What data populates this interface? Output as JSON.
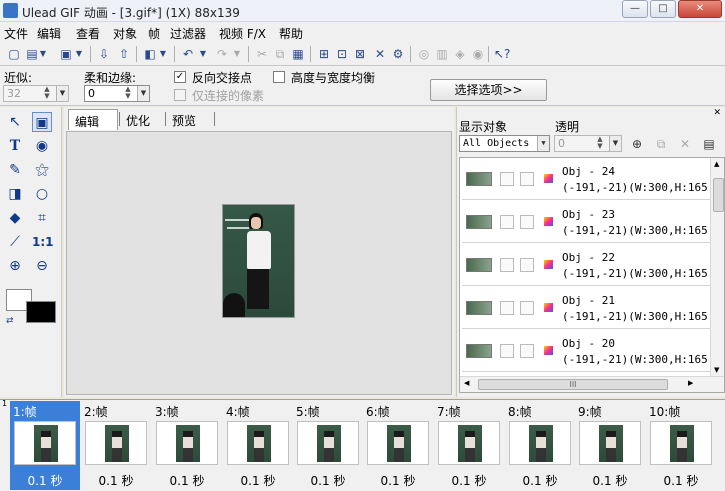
{
  "window": {
    "title": "Ulead GIF 动画 - [3.gif*] (1X) 88x139",
    "minimize": "—",
    "maximize": "□",
    "close": "✕"
  },
  "menu": [
    "文件",
    "编辑",
    "查看",
    "对象",
    "帧",
    "过滤器",
    "视频 F/X",
    "帮助"
  ],
  "props": {
    "tolerance_label": "近似:",
    "tolerance_value": "32",
    "feather_label": "柔和边缘:",
    "feather_value": "0",
    "reverse_select_label": "反向交接点",
    "reverse_select_checked": "✓",
    "connected_pixels_label": "仅连接的像素",
    "equal_wh_label": "高度与宽度均衡",
    "options_button": "选择选项>>"
  },
  "tabs": [
    "编辑",
    "优化",
    "预览"
  ],
  "object_panel": {
    "show_objects_label": "显示对象",
    "show_objects_value": "All Objects",
    "transparency_label": "透明",
    "transparency_value": "0",
    "objects": [
      {
        "name": "Obj - 24",
        "coords": "(-191,-21)(W:300,H:165"
      },
      {
        "name": "Obj - 23",
        "coords": "(-191,-21)(W:300,H:165"
      },
      {
        "name": "Obj - 22",
        "coords": "(-191,-21)(W:300,H:165"
      },
      {
        "name": "Obj - 21",
        "coords": "(-191,-21)(W:300,H:165"
      },
      {
        "name": "Obj - 20",
        "coords": "(-191,-21)(W:300,H:165"
      }
    ],
    "hscroll_grip": "III"
  },
  "frames": [
    {
      "label": "1:帧",
      "delay": "0.1 秒"
    },
    {
      "label": "2:帧",
      "delay": "0.1 秒"
    },
    {
      "label": "3:帧",
      "delay": "0.1 秒"
    },
    {
      "label": "4:帧",
      "delay": "0.1 秒"
    },
    {
      "label": "5:帧",
      "delay": "0.1 秒"
    },
    {
      "label": "6:帧",
      "delay": "0.1 秒"
    },
    {
      "label": "7:帧",
      "delay": "0.1 秒"
    },
    {
      "label": "8:帧",
      "delay": "0.1 秒"
    },
    {
      "label": "9:帧",
      "delay": "0.1 秒"
    },
    {
      "label": "10:帧",
      "delay": "0.1 秒"
    }
  ],
  "frame_index_marker": "1",
  "colors": {
    "selection_blue": "#3b7fd9",
    "foreground": "#000000",
    "background": "#ffffff"
  }
}
